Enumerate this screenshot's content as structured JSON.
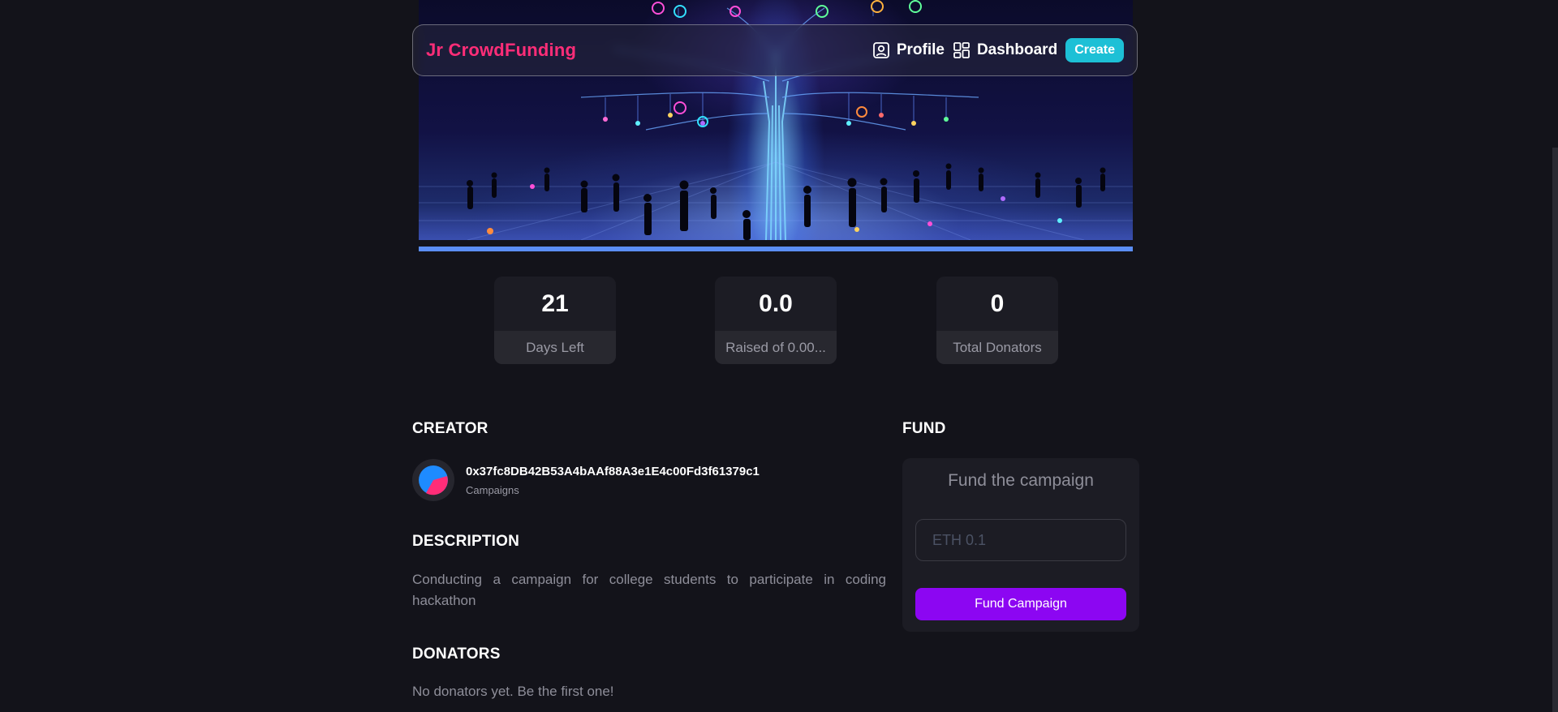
{
  "navbar": {
    "brand": "Jr CrowdFunding",
    "profile_label": "Profile",
    "dashboard_label": "Dashboard",
    "create_label": "Create"
  },
  "campaign": {
    "progress_fraction": 1.0
  },
  "stats": [
    {
      "value": "21",
      "label": "Days Left"
    },
    {
      "value": "0.0",
      "label": "Raised of 0.00..."
    },
    {
      "value": "0",
      "label": "Total Donators"
    }
  ],
  "creator": {
    "title": "Creator",
    "address": "0x37fc8DB42B53A4bAAf88A3e1E4c00Fd3f61379c1",
    "subtitle": "Campaigns"
  },
  "description": {
    "title": "Description",
    "text": "Conducting a campaign for college students to participate in coding hackathon"
  },
  "donators": {
    "title": "Donators",
    "empty_text": "No donators yet. Be the first one!"
  },
  "fund": {
    "title": "Fund",
    "card_title": "Fund the campaign",
    "input_placeholder": "ETH 0.1",
    "button_label": "Fund Campaign"
  },
  "colors": {
    "background": "#13131a",
    "brand": "#ff2d78",
    "create_button": "#1dc0d6",
    "fund_button": "#8c06f2",
    "progress": "#5b8ef5"
  },
  "icons": {
    "profile": "user-square-icon",
    "dashboard": "grid-icon"
  }
}
